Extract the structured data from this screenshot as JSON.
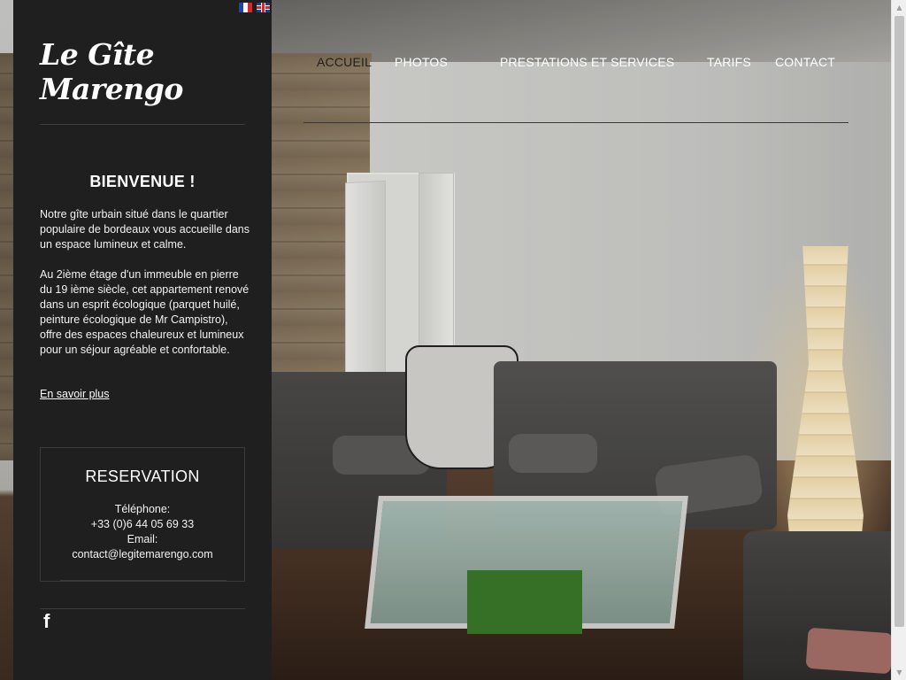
{
  "site": {
    "logo": "Le Gîte Marengo"
  },
  "languages": [
    {
      "code": "fr",
      "icon": "flag-fr-icon"
    },
    {
      "code": "en",
      "icon": "flag-uk-icon"
    }
  ],
  "nav": {
    "items": [
      {
        "label": "ACCUEIL",
        "active": true
      },
      {
        "label": "PHOTOS",
        "active": false
      },
      {
        "label": "PRESTATIONS ET SERVICES",
        "active": false
      },
      {
        "label": "TARIFS",
        "active": false
      },
      {
        "label": "CONTACT",
        "active": false
      }
    ]
  },
  "welcome": {
    "title": "BIENVENUE !",
    "paragraph1": "Notre gîte urbain situé dans le quartier populaire de bordeaux vous accueille dans un espace lumineux et calme.",
    "paragraph2": "Au 2ième étage d'un immeuble en pierre du 19 ième siècle, cet appartement renové dans un esprit écologique (parquet huilé, peinture écologique de Mr Campistro), offre des espaces chaleureux et lumineux pour un séjour agréable et confortable.",
    "more_link": "En savoir plus"
  },
  "reservation": {
    "title": "RESERVATION",
    "phone_label": "Téléphone:",
    "phone": "+33 (0)6 44 05 69 33",
    "email_label": "Email:",
    "email": "contact@legitemarengo.com"
  },
  "social": {
    "facebook_glyph": "f",
    "icon": "facebook-icon"
  },
  "colors": {
    "sidebar_bg": "#1f1f1f",
    "text": "#ffffff",
    "active_nav": "#1f1f1f"
  }
}
